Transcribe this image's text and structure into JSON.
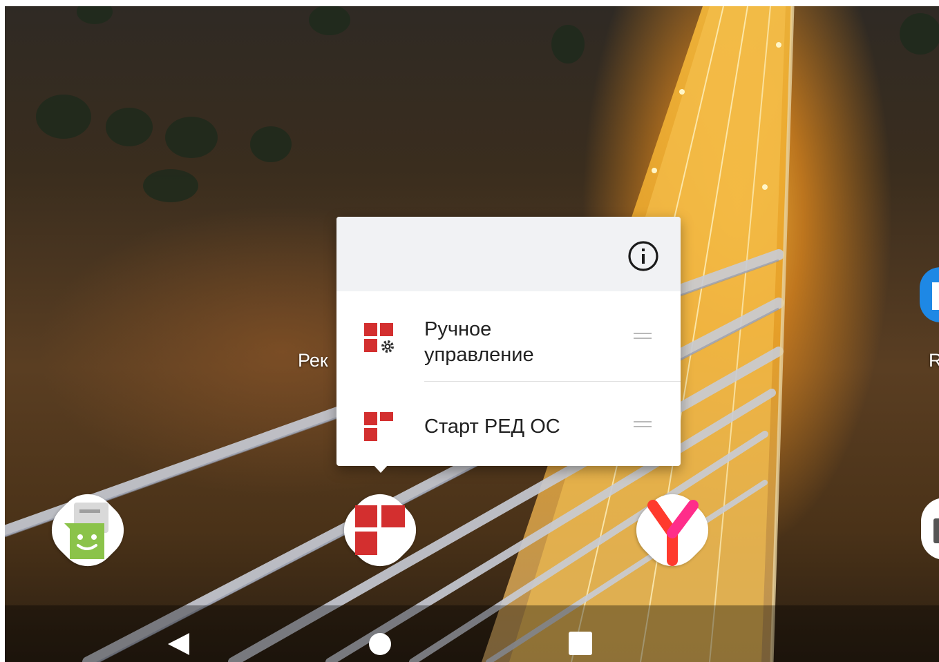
{
  "home": {
    "left_app_label": "Рек",
    "right_app_label": "R"
  },
  "popup": {
    "info_icon": "info-icon",
    "shortcuts": [
      {
        "label_line1": "Ручное",
        "label_line2": "управление",
        "icon": "red-os-settings-icon"
      },
      {
        "label": "Старт РЕД ОС",
        "icon": "red-os-icon"
      }
    ]
  },
  "dock": [
    {
      "icon": "messaging-app-icon"
    },
    {
      "icon": "red-os-app-icon"
    },
    {
      "icon": "yandex-browser-icon"
    }
  ],
  "navbar": {
    "back": "back-icon",
    "home": "home-icon",
    "recents": "recents-icon"
  },
  "colors": {
    "red_os": "#d32f2f",
    "messaging_green": "#8bc34a",
    "yandex_red": "#ff2d2d",
    "right_app_blue": "#1e88e5"
  }
}
